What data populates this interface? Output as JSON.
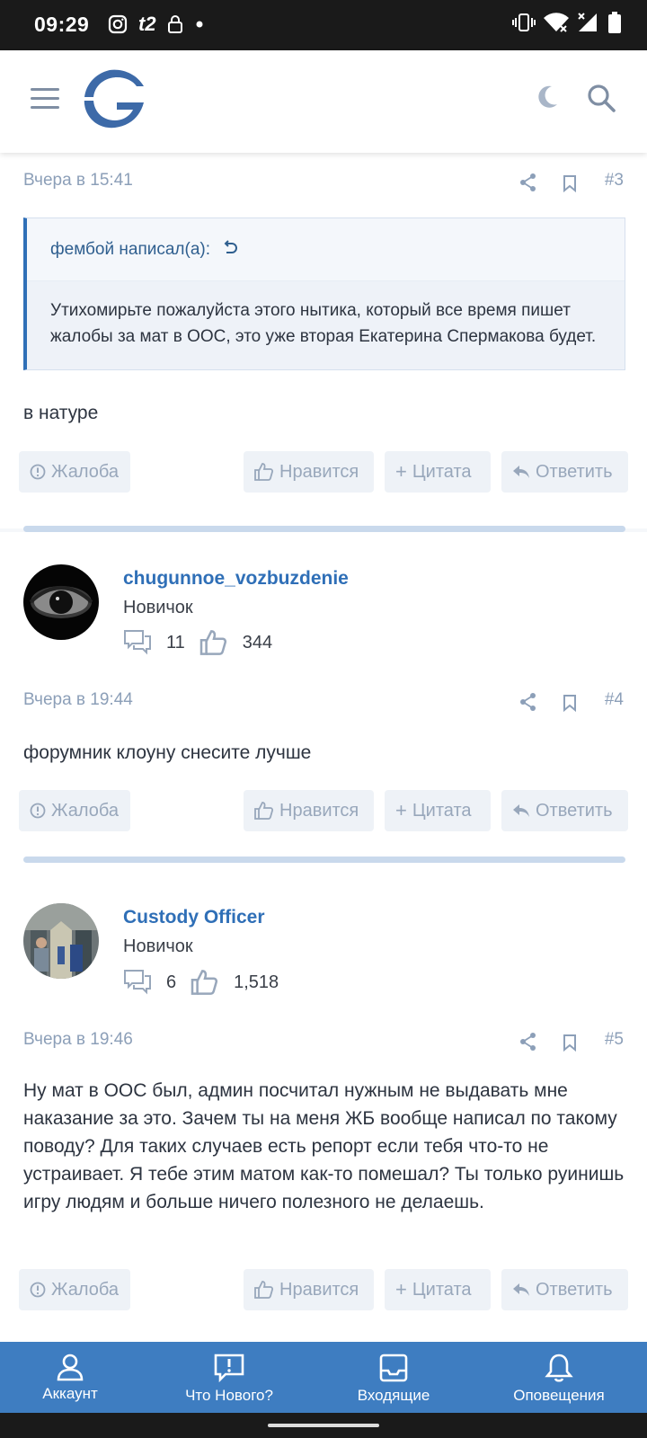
{
  "status_bar": {
    "time": "09:29",
    "carrier": "t2"
  },
  "header": {
    "menu_icon": "hamburger-icon",
    "logo_icon": "site-logo-icon",
    "theme_icon": "moon-icon",
    "search_icon": "search-icon"
  },
  "posts": [
    {
      "time": "Вчера в 15:41",
      "number": "#3",
      "quote_author": "фембой написал(а):",
      "quote_text": "Утихомирьте пожалуйста этого нытика, который все время пишет жалобы за мат в ООС, это уже вторая Екатерина Спермакова будет.",
      "text": "в натуре"
    },
    {
      "time": "Вчера в 19:44",
      "number": "#4",
      "text": "форумник клоуну снесите лучше"
    },
    {
      "time": "Вчера в 19:46",
      "number": "#5",
      "text": "Ну мат в ООС был, админ посчитал нужным не выдавать мне наказание за это. Зачем ты на меня ЖБ вообще написал по такому поводу? Для таких случаев есть репорт если тебя что-то не устраивает. Я тебе этим матом как-то помешал? Ты только руинишь игру людям и больше ничего полезного не делаешь."
    }
  ],
  "users": [
    {
      "name": "chugunnoe_vozbuzdenie",
      "role": "Новичок",
      "messages": "11",
      "likes": "344"
    },
    {
      "name": "Custody Officer",
      "role": "Новичок",
      "messages": "6",
      "likes": "1,518"
    }
  ],
  "actions": {
    "report": "Жалоба",
    "like": "Нравится",
    "quote": "Цитата",
    "reply": "Ответить"
  },
  "bottom_nav": {
    "account": "Аккаунт",
    "whats_new": "Что Нового?",
    "inbox": "Входящие",
    "alerts": "Оповещения"
  },
  "colors": {
    "accent": "#2f6fb7",
    "nav_bg": "#3e7dc1",
    "muted": "#8c9fb8"
  }
}
